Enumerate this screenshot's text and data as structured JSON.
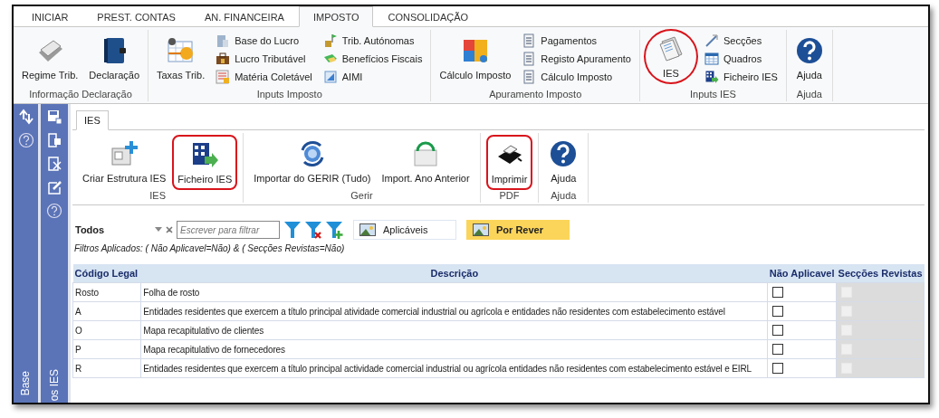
{
  "tabs": [
    {
      "label": "INICIAR",
      "selected": false
    },
    {
      "label": "PREST. CONTAS",
      "selected": false
    },
    {
      "label": "AN. FINANCEIRA",
      "selected": false
    },
    {
      "label": "IMPOSTO",
      "selected": true
    },
    {
      "label": "CONSOLIDAÇÃO",
      "selected": false
    }
  ],
  "ribbon": {
    "groups": [
      {
        "label": "Informação Declaração",
        "columns": [
          {
            "kind": "large",
            "label": "Regime Trib.",
            "highlighted": false
          },
          {
            "kind": "large",
            "label": "Declaração",
            "highlighted": false
          }
        ]
      },
      {
        "label": "Inputs Imposto",
        "columns": [
          {
            "kind": "large",
            "label": "Taxas Trib.",
            "highlighted": false
          },
          {
            "kind": "stack",
            "items": [
              {
                "label": "Base do Lucro"
              },
              {
                "label": "Lucro Tributável"
              },
              {
                "label": "Matéria Coletável"
              }
            ]
          },
          {
            "kind": "stack",
            "items": [
              {
                "label": "Trib. Autónomas"
              },
              {
                "label": "Benefícios Fiscais"
              },
              {
                "label": "AIMI"
              }
            ]
          }
        ]
      },
      {
        "label": "Apuramento Imposto",
        "columns": [
          {
            "kind": "large",
            "label": "Cálculo Imposto",
            "highlighted": false
          },
          {
            "kind": "stack",
            "items": [
              {
                "label": "Pagamentos"
              },
              {
                "label": "Registo Apuramento"
              },
              {
                "label": "Cálculo Imposto"
              }
            ]
          }
        ]
      },
      {
        "label": "Inputs IES",
        "columns": [
          {
            "kind": "large",
            "label": "IES",
            "highlighted": true
          },
          {
            "kind": "stack",
            "items": [
              {
                "label": "Secções"
              },
              {
                "label": "Quadros"
              },
              {
                "label": "Ficheiro IES"
              }
            ]
          }
        ]
      },
      {
        "label": "Ajuda",
        "columns": [
          {
            "kind": "large",
            "label": "Ajuda",
            "highlighted": false
          }
        ]
      }
    ]
  },
  "sidebar": {
    "panels": [
      {
        "label": "Base"
      },
      {
        "label": "os IES"
      }
    ]
  },
  "document": {
    "tabs": [
      {
        "label": "IES",
        "selected": true
      }
    ],
    "groups": [
      {
        "label": "IES",
        "buttons": [
          {
            "label": "Criar Estrutura IES",
            "highlighted": false
          },
          {
            "label": "Ficheiro IES",
            "highlighted": true
          }
        ]
      },
      {
        "label": "Gerir",
        "buttons": [
          {
            "label": "Importar do GERIR (Tudo)",
            "highlighted": false
          },
          {
            "label": "Import. Ano Anterior",
            "highlighted": false
          }
        ]
      },
      {
        "label": "PDF",
        "buttons": [
          {
            "label": "Imprimir",
            "highlighted": true
          }
        ]
      },
      {
        "label": "Ajuda",
        "buttons": [
          {
            "label": "Ajuda",
            "highlighted": false
          }
        ]
      }
    ]
  },
  "filter": {
    "dropdown_value": "Todos",
    "search_placeholder": "Escrever para filtrar",
    "toggles": [
      {
        "label": "Aplicáveis",
        "selected": false
      },
      {
        "label": "Por Rever",
        "selected": true
      }
    ],
    "applied_text": "Filtros Aplicados: ( Não Aplicavel=Não) & ( Secções Revistas=Não)"
  },
  "table": {
    "columns": [
      "Código Legal",
      "Descrição",
      "Não Aplicavel",
      "Secções Revistas"
    ],
    "rows": [
      {
        "code": "Rosto",
        "description": "Folha de rosto",
        "nao_aplicavel": false,
        "seccoes_revistas": false,
        "revistas_disabled": true
      },
      {
        "code": "A",
        "description": "Entidades residentes que exercem a título principal atividade comercial industrial ou agrícola e entidades não residentes com estabelecimento estável",
        "nao_aplicavel": false,
        "seccoes_revistas": false,
        "revistas_disabled": true
      },
      {
        "code": "O",
        "description": "Mapa recapitulativo de clientes",
        "nao_aplicavel": false,
        "seccoes_revistas": false,
        "revistas_disabled": true
      },
      {
        "code": "P",
        "description": "Mapa recapitulativo de fornecedores",
        "nao_aplicavel": false,
        "seccoes_revistas": false,
        "revistas_disabled": true
      },
      {
        "code": "R",
        "description": "Entidades residentes que exercem a título principal actividade comercial industrial ou agrícola entidades não residentes com estabelecimento estável e EIRL",
        "nao_aplicavel": false,
        "seccoes_revistas": false,
        "revistas_disabled": true
      }
    ]
  }
}
